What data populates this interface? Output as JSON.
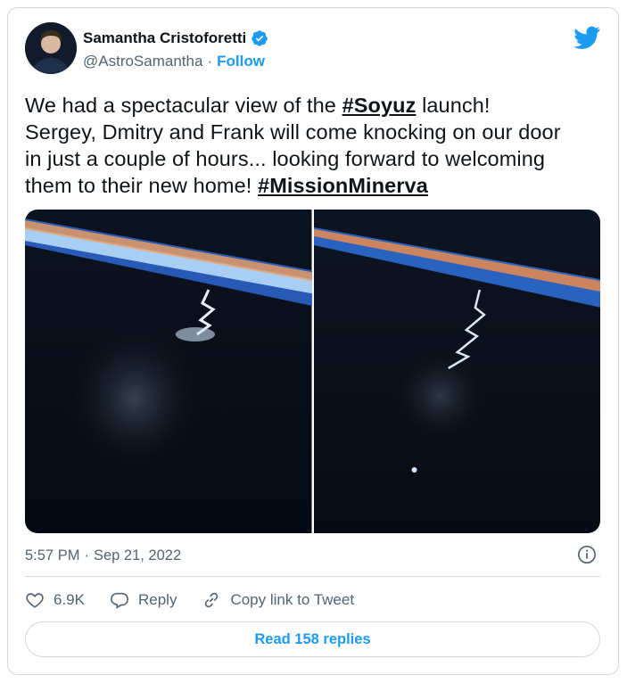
{
  "author": {
    "name": "Samantha Cristoforetti",
    "handle": "@AstroSamantha",
    "separator": "·",
    "follow_label": "Follow"
  },
  "tweet": {
    "lines": [
      {
        "pre": "We had a spectacular view of the ",
        "tag": "#Soyuz",
        "post": " launch!"
      },
      {
        "pre": "Sergey, Dmitry and Frank will come knocking on our door",
        "tag": "",
        "post": ""
      },
      {
        "pre": "in just a couple of hours... looking forward to welcoming",
        "tag": "",
        "post": ""
      },
      {
        "pre": "them to their new home! ",
        "tag": "#MissionMinerva",
        "post": ""
      }
    ]
  },
  "meta": {
    "time": "5:57 PM",
    "separator": "·",
    "date": "Sep 21, 2022"
  },
  "actions": {
    "likes": "6.9K",
    "reply": "Reply",
    "copy_link": "Copy link to Tweet"
  },
  "replies_button": "Read 158 replies",
  "colors": {
    "accent": "#1d9bf0",
    "text": "#0f1419",
    "muted": "#536471",
    "border": "#cfd9de"
  },
  "icons": [
    "verified-badge-icon",
    "twitter-bird-icon",
    "info-icon",
    "heart-icon",
    "reply-bubble-icon",
    "link-icon"
  ]
}
